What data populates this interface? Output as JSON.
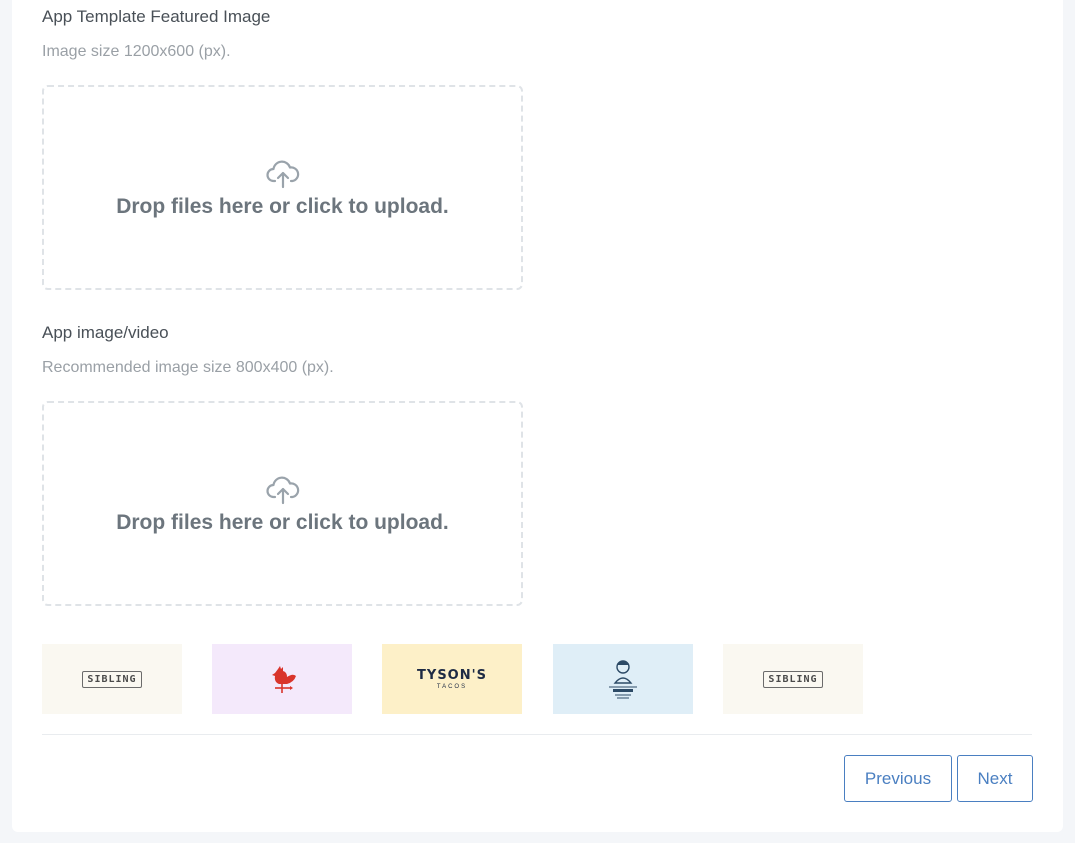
{
  "featured": {
    "label": "App Template Featured Image",
    "hint": "Image size 1200x600 (px).",
    "dropzone_text": "Drop files here or click to upload."
  },
  "media": {
    "label": "App image/video",
    "hint": "Recommended image size 800x400 (px).",
    "dropzone_text": "Drop files here or click to upload."
  },
  "thumbnails": [
    {
      "logo_text": "SIBLING",
      "bg": "#faf8f1"
    },
    {
      "logo_text": "",
      "bg": "#f4e9fb",
      "icon": "rooster-weathervane-icon"
    },
    {
      "logo_text": "TYSON'S",
      "logo_sub": "TACOS",
      "bg": "#fdf0c8"
    },
    {
      "logo_text": "",
      "bg": "#dfeef7",
      "icon": "chef-emblem-icon"
    },
    {
      "logo_text": "SIBLING",
      "bg": "#faf8f1"
    }
  ],
  "nav": {
    "previous_label": "Previous",
    "next_label": "Next"
  },
  "colors": {
    "accent": "#4a7fc1",
    "dropzone_border": "#dfe3e7",
    "label": "#495057",
    "hint": "#9aa0a6"
  }
}
